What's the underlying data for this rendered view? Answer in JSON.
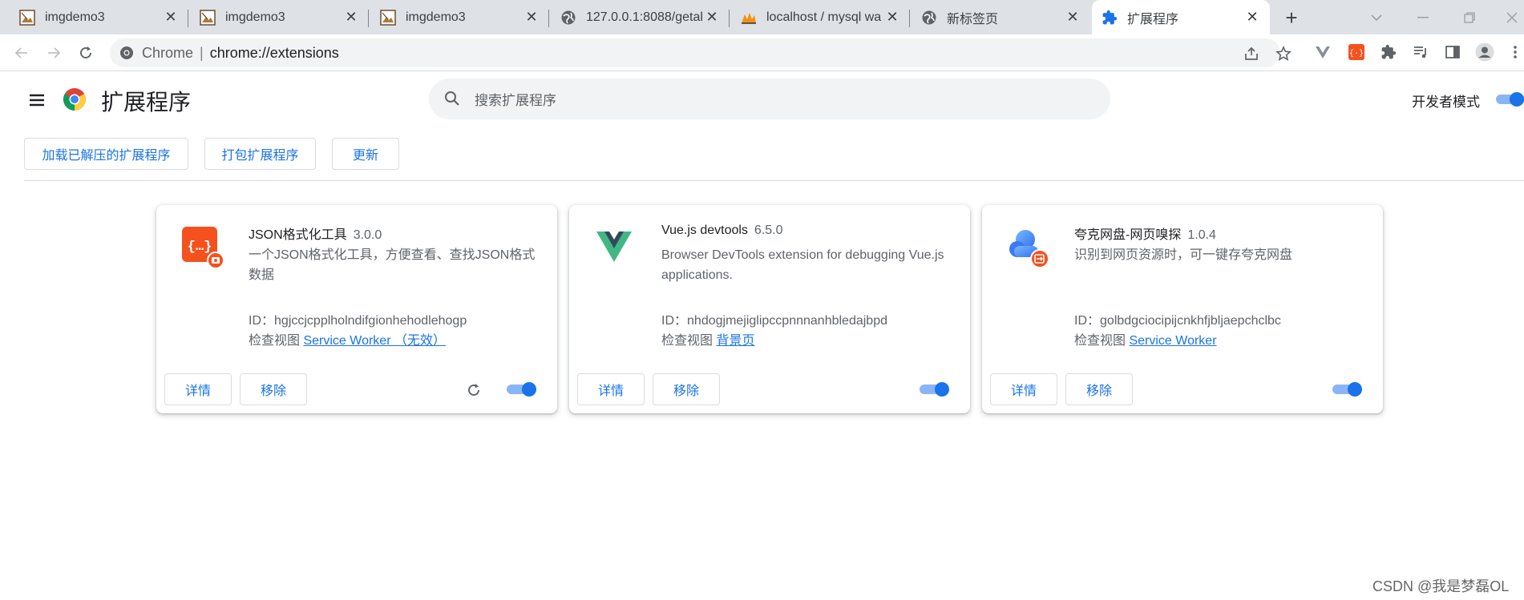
{
  "tabs": [
    {
      "title": "imgdemo3",
      "favicon": "image-icon"
    },
    {
      "title": "imgdemo3",
      "favicon": "image-icon"
    },
    {
      "title": "imgdemo3",
      "favicon": "image-icon"
    },
    {
      "title": "127.0.0.1:8088/getal",
      "favicon": "globe-icon"
    },
    {
      "title": "localhost / mysql wa",
      "favicon": "phpmyadmin-icon"
    },
    {
      "title": "新标签页",
      "favicon": "globe-icon"
    },
    {
      "title": "扩展程序",
      "favicon": "puzzle-icon",
      "active": true
    }
  ],
  "toolbar": {
    "omnibox_label": "Chrome",
    "omnibox_sep": "|",
    "url": "chrome://extensions"
  },
  "page": {
    "title": "扩展程序",
    "search_placeholder": "搜索扩展程序",
    "dev_mode_label": "开发者模式",
    "dev_mode_on": true
  },
  "actions": {
    "load_unpacked": "加载已解压的扩展程序",
    "pack": "打包扩展程序",
    "update": "更新"
  },
  "extensions": [
    {
      "name": "JSON格式化工具",
      "version": "3.0.0",
      "description": "一个JSON格式化工具，方便查看、查找JSON格式数据",
      "id_label": "ID：",
      "id": "hgjccjcpplholndifgionhehodlehogp",
      "inspect_label": "检查视图",
      "inspect_link": "Service Worker （无效）",
      "details": "详情",
      "remove": "移除",
      "enabled": true,
      "has_reload": true
    },
    {
      "name": "Vue.js devtools",
      "version": "6.5.0",
      "description": "Browser DevTools extension for debugging Vue.js applications.",
      "id_label": "ID：",
      "id": "nhdogjmejiglipccpnnnanhbledajbpd",
      "inspect_label": "检查视图",
      "inspect_link": "背景页",
      "details": "详情",
      "remove": "移除",
      "enabled": true,
      "has_reload": false
    },
    {
      "name": "夸克网盘-网页嗅探",
      "version": "1.0.4",
      "description": "识别到网页资源时，可一键存夸克网盘",
      "id_label": "ID：",
      "id": "golbdgciocipijcnkhfjbljaepchclbc",
      "inspect_label": "检查视图",
      "inspect_link": "Service Worker",
      "details": "详情",
      "remove": "移除",
      "enabled": true,
      "has_reload": false
    }
  ],
  "watermark": "CSDN @我是梦磊OL",
  "colors": {
    "accent": "#1a73e8",
    "tabstrip": "#dee1e6",
    "json_icon": "#f4511e",
    "vue_green": "#41b883",
    "vue_dark": "#34495e"
  }
}
